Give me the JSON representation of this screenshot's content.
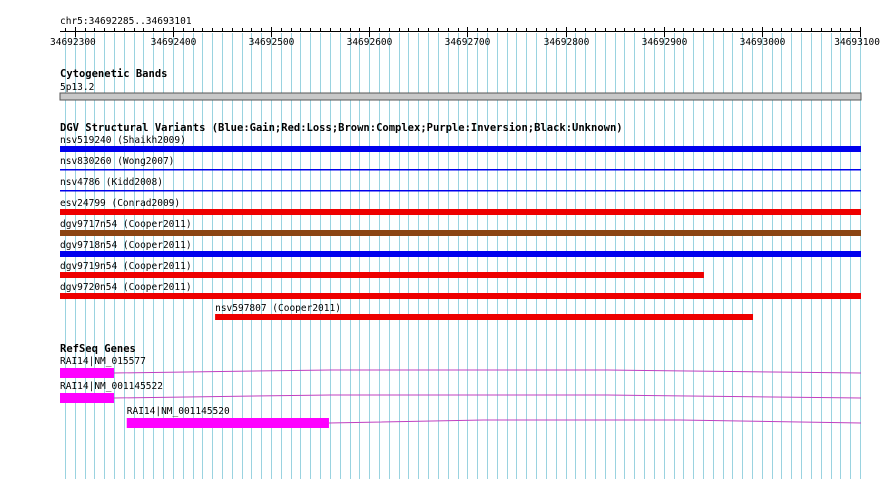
{
  "view": {
    "location_label": "chr5:34692285..34693101",
    "start": 34692285,
    "end": 34693101,
    "ticks": [
      34692300,
      34692400,
      34692500,
      34692600,
      34692700,
      34692800,
      34692900,
      34693000,
      34693100
    ],
    "minor_tick_step": 10,
    "grid_color": "#9ad3e0"
  },
  "tracks": {
    "cyto": {
      "title": "Cytogenetic Bands",
      "band_label": "5p13.2",
      "band_color": "#c8c8c8"
    },
    "dgv": {
      "title": "DGV Structural Variants (Blue:Gain;Red:Loss;Brown:Complex;Purple:Inversion;Black:Unknown)",
      "colors": {
        "gain": "#0000ee",
        "loss": "#ee0000",
        "complex": "#8b4513",
        "inversion": "#800080",
        "unknown": "#000000"
      },
      "features": [
        {
          "name": "nsv519240 (Shaikh2009)",
          "start": 34692285,
          "end": 34693101,
          "type": "gain",
          "style": "thick"
        },
        {
          "name": "nsv830260 (Wong2007)",
          "start": 34692285,
          "end": 34693101,
          "type": "gain",
          "style": "thin"
        },
        {
          "name": "nsv4786 (Kidd2008)",
          "start": 34692285,
          "end": 34693101,
          "type": "gain",
          "style": "thin"
        },
        {
          "name": "esv24799 (Conrad2009)",
          "start": 34692285,
          "end": 34693101,
          "type": "loss",
          "style": "thick"
        },
        {
          "name": "dgv9717n54 (Cooper2011)",
          "start": 34692285,
          "end": 34693101,
          "type": "complex",
          "style": "thick"
        },
        {
          "name": "dgv9718n54 (Cooper2011)",
          "start": 34692285,
          "end": 34693101,
          "type": "gain",
          "style": "thick"
        },
        {
          "name": "dgv9719n54 (Cooper2011)",
          "start": 34692285,
          "end": 34692941,
          "type": "loss",
          "style": "thick"
        },
        {
          "name": "dgv9720n54 (Cooper2011)",
          "start": 34692285,
          "end": 34693101,
          "type": "loss",
          "style": "thick"
        },
        {
          "name": "nsv597807 (Cooper2011)",
          "start": 34692443,
          "end": 34692991,
          "type": "loss",
          "style": "thick"
        }
      ]
    },
    "refseq": {
      "title": "RefSeq Genes",
      "exon_color": "#ff00ff",
      "intron_color": "#c040c0",
      "genes": [
        {
          "name": "RAI14|NM_015577",
          "exon_start": 34692285,
          "exon_end": 34692340,
          "line_end": 34693101
        },
        {
          "name": "RAI14|NM_001145522",
          "exon_start": 34692285,
          "exon_end": 34692340,
          "line_end": 34693101
        },
        {
          "name": "RAI14|NM_001145520",
          "exon_start": 34692353,
          "exon_end": 34692559,
          "line_end": 34693101
        }
      ]
    }
  }
}
